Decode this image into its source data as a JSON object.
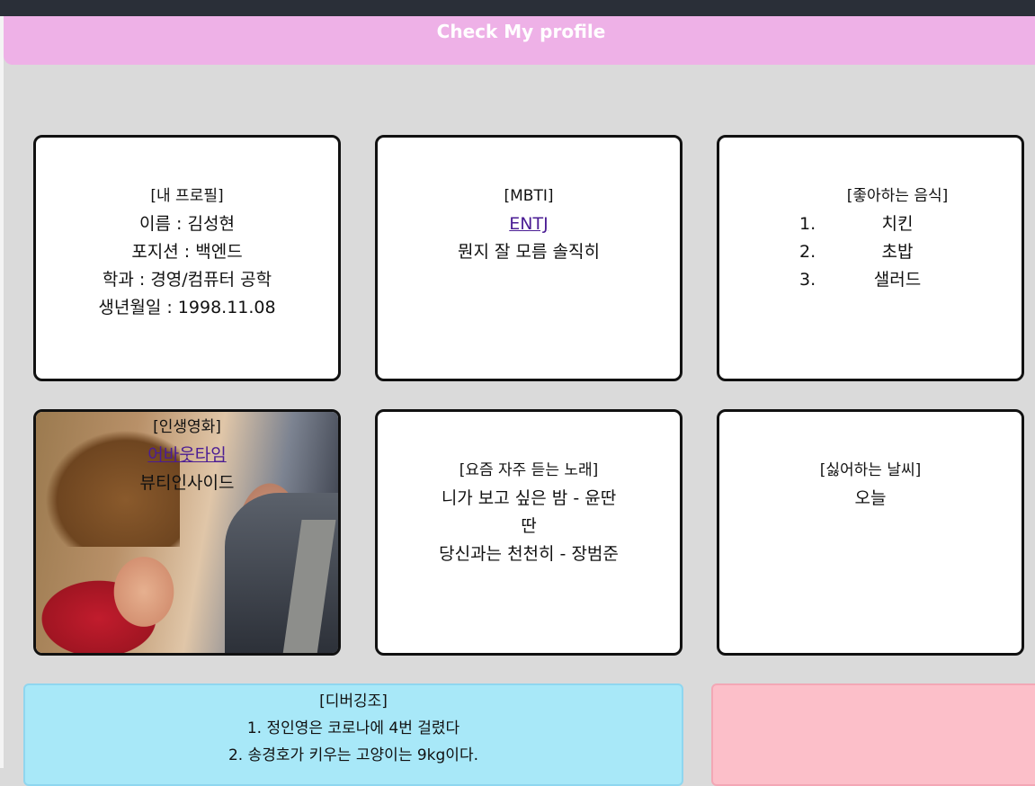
{
  "header": {
    "title": "Check My profile"
  },
  "profile": {
    "title": "[내 프로필]",
    "name": "이름 : 김성현",
    "position": "포지션 : 백엔드",
    "major": "학과 : 경영/컴퓨터 공학",
    "birthday": "생년월일 : 1998.11.08"
  },
  "mbti": {
    "title": "[MBTI]",
    "type": "ENTJ",
    "comment": "뭔지 잘 모름 솔직히"
  },
  "food": {
    "title": "[좋아하는 음식]",
    "items": [
      {
        "num": "1.",
        "label": "치킨"
      },
      {
        "num": "2.",
        "label": "초밥"
      },
      {
        "num": "3.",
        "label": "샐러드"
      }
    ]
  },
  "movie": {
    "title": "[인생영화]",
    "first": "어바웃타임",
    "second": "뷰티인사이드"
  },
  "songs": {
    "title": "[요즘 자주 듣는 노래]",
    "song1_line1": "니가 보고 싶은 밤 - 윤딴",
    "song1_line2": "딴",
    "song2": "당신과는 천천히 - 장범준"
  },
  "weather": {
    "title": "[싫어하는 날씨]",
    "value": "오늘"
  },
  "debug": {
    "title": "[디버깅조]",
    "line1": "1. 정인영은 코로나에 4번 걸렸다",
    "line2": "2. 송경호가 키우는 고양이는 9kg이다."
  },
  "colors": {
    "header_bg": "#eeb1e7",
    "page_bg": "#dadada",
    "blue_box": "#a8e8f8",
    "pink_box": "#fcbfc9",
    "link": "#4b1d94"
  }
}
